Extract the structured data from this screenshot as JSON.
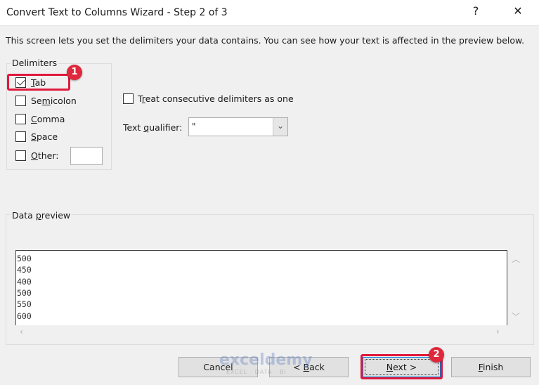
{
  "window": {
    "title": "Convert Text to Columns Wizard - Step 2 of 3",
    "help": "?",
    "close": "✕"
  },
  "instruction": "This screen lets you set the delimiters your data contains.  You can see how your text is affected in the preview below.",
  "delimiters": {
    "legend": "Delimiters",
    "items": [
      {
        "pre": "",
        "u": "T",
        "post": "ab",
        "checked": true
      },
      {
        "pre": "Se",
        "u": "m",
        "post": "icolon",
        "checked": false
      },
      {
        "pre": "",
        "u": "C",
        "post": "omma",
        "checked": false
      },
      {
        "pre": "",
        "u": "S",
        "post": "pace",
        "checked": false
      },
      {
        "pre": "",
        "u": "O",
        "post": "ther:",
        "checked": false
      }
    ],
    "other_value": ""
  },
  "consecutive": {
    "pre": "T",
    "u": "r",
    "post": "eat consecutive delimiters as one",
    "checked": false
  },
  "qualifier": {
    "pre": "Text ",
    "u": "q",
    "post": "ualifier:",
    "value": "\""
  },
  "preview": {
    "legend_pre": "Data ",
    "legend_u": "p",
    "legend_post": "review",
    "rows": [
      "500",
      "450",
      "400",
      "500",
      "550",
      "600"
    ]
  },
  "buttons": {
    "cancel": "Cancel",
    "back_pre": "< ",
    "back_u": "B",
    "back_post": "ack",
    "next_u": "N",
    "next_post": "ext >",
    "finish_u": "F",
    "finish_post": "inish"
  },
  "annotations": {
    "badge1": "1",
    "badge2": "2",
    "color": "#e0193c"
  },
  "watermark": {
    "brand": "exceldemy",
    "tagline": "EXCEL · DATA · BI"
  }
}
